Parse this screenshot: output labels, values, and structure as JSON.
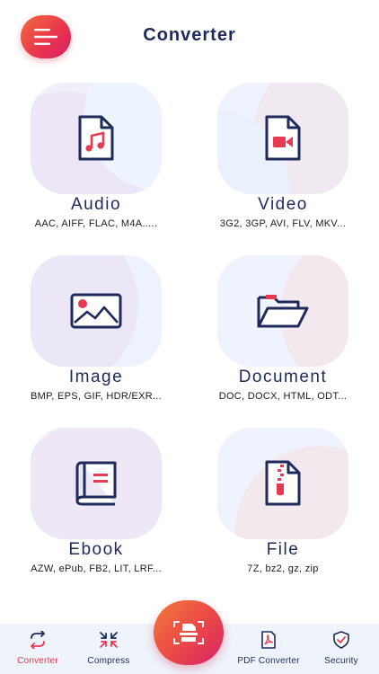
{
  "header": {
    "title": "Converter",
    "menu_icon": "hamburger-menu-icon"
  },
  "colors": {
    "accent": "#e63a50",
    "navy": "#1f2a5c",
    "card_bg": "#eef3fd"
  },
  "cards": [
    {
      "title": "Audio",
      "formats": "AAC, AIFF, FLAC, M4A.....",
      "icon": "audio-file-icon"
    },
    {
      "title": "Video",
      "formats": "3G2, 3GP, AVI, FLV, MKV...",
      "icon": "video-file-icon"
    },
    {
      "title": "Image",
      "formats": "BMP, EPS, GIF, HDR/EXR...",
      "icon": "image-icon"
    },
    {
      "title": "Document",
      "formats": "DOC, DOCX, HTML, ODT...",
      "icon": "folder-icon"
    },
    {
      "title": "Ebook",
      "formats": "AZW,  ePub, FB2,  LIT, LRF...",
      "icon": "book-icon"
    },
    {
      "title": "File",
      "formats": "7Z, bz2, gz, zip",
      "icon": "zip-file-icon"
    }
  ],
  "bottom_nav": {
    "tabs": [
      {
        "label": "Converter",
        "icon": "convert-arrows-icon",
        "active": true
      },
      {
        "label": "Compress",
        "icon": "compress-arrows-icon",
        "active": false
      },
      {
        "label": "PDF Converter",
        "icon": "pdf-file-icon",
        "active": false
      },
      {
        "label": "Security",
        "icon": "shield-check-icon",
        "active": false
      }
    ],
    "center_action_icon": "scanner-icon"
  }
}
